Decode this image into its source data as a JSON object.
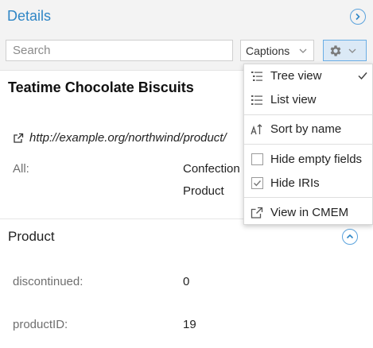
{
  "header": {
    "title": "Details",
    "search": {
      "placeholder": "Search",
      "value": ""
    },
    "captions_select": {
      "selected": "Captions"
    }
  },
  "entity": {
    "title": "Teatime Chocolate Biscuits",
    "iri": "http://example.org/northwind/product/",
    "all_label": "All:",
    "all_values": [
      "Confection",
      "Product"
    ]
  },
  "sections": [
    {
      "title": "Product",
      "properties": [
        {
          "label": "discontinued:",
          "value": "0"
        },
        {
          "label": "productID:",
          "value": "19"
        }
      ]
    }
  ],
  "menu": {
    "items": [
      {
        "label": "Tree view",
        "icon": "tree-view-icon",
        "checked": true
      },
      {
        "label": "List view",
        "icon": "list-view-icon",
        "checked": false
      },
      {
        "label": "Sort by name",
        "icon": "sort-alpha-icon",
        "checked": false
      },
      {
        "label": "Hide empty fields",
        "icon": "checkbox-icon",
        "checked": false
      },
      {
        "label": "Hide IRIs",
        "icon": "checkbox-icon",
        "checked": true
      },
      {
        "label": "View in CMEM",
        "icon": "external-link-icon",
        "checked": false
      }
    ]
  },
  "colors": {
    "accent": "#2f86c6",
    "header_bg": "#f3f3f3",
    "settings_button_bg": "#dbe9f6"
  }
}
